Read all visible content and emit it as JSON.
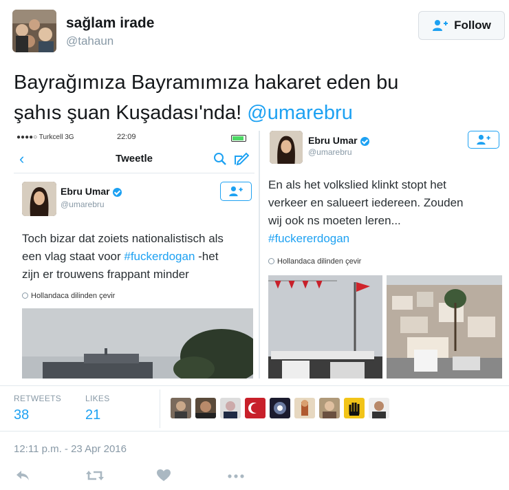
{
  "user": {
    "display_name": "sağlam irade",
    "handle": "@tahaun",
    "avatar_icon": "group-photo-avatar"
  },
  "follow_button": {
    "label": "Follow",
    "icon": "add-user-icon"
  },
  "tweet": {
    "text_line1": "Bayrağımıza Bayramımıza hakaret eden bu",
    "text_line2": "şahıs şuan Kuşadası'nda!",
    "mention": "@umarebru"
  },
  "left_screenshot": {
    "status": {
      "carrier": "●●●●○ Turkcell  3G",
      "time": "22:09"
    },
    "nav_title": "Tweetle",
    "author": {
      "name": "Ebru Umar",
      "handle": "@umarebru"
    },
    "text_lines": [
      "Toch bizar dat zoiets nationalistisch als",
      "een vlag staat voor ",
      "zijn er trouwens frappant minder"
    ],
    "hashtag": "#fuckerdogan",
    "after_hashtag": " -het",
    "translate": "Hollandaca dilinden çevir"
  },
  "right_screenshot": {
    "author": {
      "name": "Ebru Umar",
      "handle": "@umarebru"
    },
    "text_lines": [
      "En als het volkslied klinkt stopt het",
      "verkeer en salueert iedereen. Zouden",
      "wij ook ns moeten leren..."
    ],
    "hashtag": "#fuckererdogan",
    "translate": "Hollandaca dilinden çevir"
  },
  "stats": {
    "retweets_label": "RETWEETS",
    "retweets_value": "38",
    "likes_label": "LIKES",
    "likes_value": "21",
    "likers_count": 9
  },
  "timestamp": "12:11 p.m. - 23 Apr 2016",
  "colors": {
    "accent": "#1da1f2",
    "muted": "#8899a6"
  }
}
